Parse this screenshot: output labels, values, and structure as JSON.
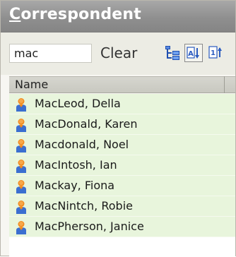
{
  "panel": {
    "title": "Correspondent",
    "title_mnemonic": "C",
    "title_rest": "orrespondent"
  },
  "toolbar": {
    "search_value": "mac",
    "clear_label": "Clear",
    "tree_view_icon": "tree-view-icon",
    "sort_az_icon": "sort-alpha-icon",
    "sort_numeric_icon": "sort-numeric-icon",
    "sort_az_active": true
  },
  "list": {
    "column_header": "Name",
    "row_icon": "person-icon",
    "items": [
      "MacLeod, Della",
      "MacDonald, Karen",
      "Macdonald, Noel",
      "MacIntosh, Ian",
      "Mackay, Fiona",
      "MacNintch, Robie",
      "MacPherson, Janice"
    ]
  },
  "colors": {
    "title_bar": "#8f8f8f",
    "row_background": "#e8f5dc",
    "person_icon_head": "#f28a1e",
    "person_icon_body": "#3b6fd0"
  }
}
